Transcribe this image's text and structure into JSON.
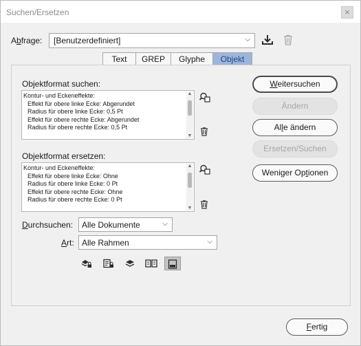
{
  "window": {
    "title": "Suchen/Ersetzen",
    "close_symbol": "×"
  },
  "query": {
    "label_pre": "A",
    "label_u": "b",
    "label_post": "frage:",
    "value": "[Benutzerdefiniert]"
  },
  "tabs": [
    {
      "label": "Text",
      "active": false
    },
    {
      "label": "GREP",
      "active": false
    },
    {
      "label": "Glyphe",
      "active": false
    },
    {
      "label": "Objekt",
      "active": true
    }
  ],
  "find_format": {
    "label": "Objektformat suchen:",
    "lines": [
      "Kontur- und Eckeneffekte:",
      "Effekt für obere linke Ecke: Abgerundet",
      "Radius für obere linke Ecke: 0,5 Pt",
      "Effekt für obere rechte Ecke: Abgerundet",
      "Radius für obere rechte Ecke: 0,5 Pt"
    ]
  },
  "replace_format": {
    "label": "Objektformat ersetzen:",
    "lines": [
      "Kontur- und Eckeneffekte:",
      "Effekt für obere linke Ecke: Ohne",
      "Radius für obere linke Ecke: 0 Pt",
      "Effekt für obere rechte Ecke: Ohne",
      "Radius für obere rechte Ecke: 0 Pt"
    ]
  },
  "search": {
    "label_pre": "",
    "label_u": "D",
    "label_post": "urchsuchen:",
    "value": "Alle Dokumente"
  },
  "type": {
    "label_pre": "",
    "label_u": "A",
    "label_post": "rt:",
    "value": "Alle Rahmen"
  },
  "buttons": {
    "find_next_pre": "",
    "find_next_u": "W",
    "find_next_post": "eitersuchen",
    "change": "Ändern",
    "change_all_pre": "Al",
    "change_all_u": "l",
    "change_all_post": "e ändern",
    "change_find": "Ersetzen/Suchen",
    "fewer_options_pre": "Weniger Op",
    "fewer_options_u": "t",
    "fewer_options_post": "ionen",
    "done_pre": "",
    "done_u": "F",
    "done_post": "ertig"
  },
  "colors": {
    "active_tab": "#9eb5da",
    "active_tab_text": "#1a4b8c",
    "disabled_text": "#a6a6a6"
  },
  "icons": {
    "save_query": "download-save-icon",
    "delete_query": "trash-icon",
    "find_format_settings": "magnify-format-icon",
    "clear_find_format": "trash-icon",
    "replace_format_settings": "magnify-format-icon",
    "clear_replace_format": "trash-icon",
    "tools": [
      "locked-layers-icon",
      "locked-items-icon",
      "hidden-layers-icon",
      "master-pages-icon",
      "footnotes-icon"
    ]
  }
}
